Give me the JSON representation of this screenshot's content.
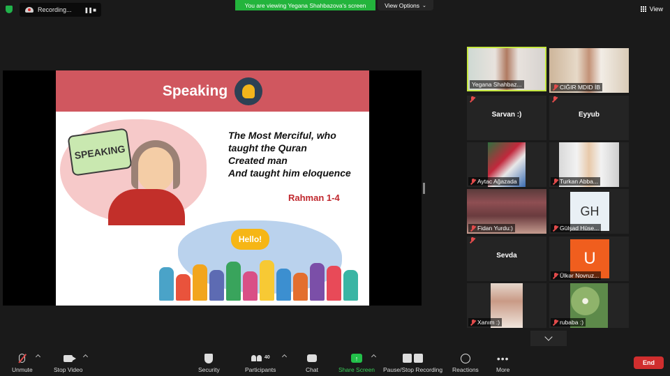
{
  "top": {
    "recording_label": "Recording...",
    "recording_controls": "❚❚  ■",
    "share_banner": "You are viewing Yegana Shahbazova's screen",
    "view_options": "View Options",
    "view_button": "View"
  },
  "slide": {
    "title": "Speaking",
    "bubble_text": "SPEAKING",
    "verse_lines": [
      "The Most Merciful, who",
      "taught the Quran",
      "Created man",
      "And taught him eloquence"
    ],
    "reference": "Rahman 1-4",
    "hello_text": "Hello!"
  },
  "participants": [
    {
      "name": "Yegana Shahbaz...",
      "muted": false,
      "video": true
    },
    {
      "name": "CIĞIR MDID İB",
      "muted": true,
      "video": true
    },
    {
      "name": "Sarvan :)",
      "muted": true,
      "video": false
    },
    {
      "name": "Eyyub",
      "muted": true,
      "video": false
    },
    {
      "name": "Aytac Ağazada",
      "muted": true,
      "video": true
    },
    {
      "name": "Turkan Abba...",
      "muted": true,
      "video": true
    },
    {
      "name": "Fidan Yurdu:)",
      "muted": true,
      "video": true
    },
    {
      "name": "Gülşad Hüse...",
      "muted": true,
      "video": true
    },
    {
      "name": "Sevda",
      "muted": true,
      "video": false
    },
    {
      "name": "Ülkər Novruz...",
      "muted": true,
      "video": true
    },
    {
      "name": "Xanım :)",
      "muted": true,
      "video": true
    },
    {
      "name": "rubaba :)",
      "muted": true,
      "video": true
    }
  ],
  "avatars": {
    "gulsad_initials": "GH",
    "ulker_initial": "U"
  },
  "toolbar": {
    "unmute": "Unmute",
    "stop_video": "Stop Video",
    "security": "Security",
    "participants": "Participants",
    "participant_count": "40",
    "chat": "Chat",
    "share_screen": "Share Screen",
    "recording": "Pause/Stop Recording",
    "reactions": "Reactions",
    "more": "More",
    "end": "End"
  },
  "colors": {
    "active_speaker_border": "#c5e73f",
    "share_banner": "#23b43c",
    "end_button": "#d02e2e",
    "slide_header": "#d0575f"
  }
}
